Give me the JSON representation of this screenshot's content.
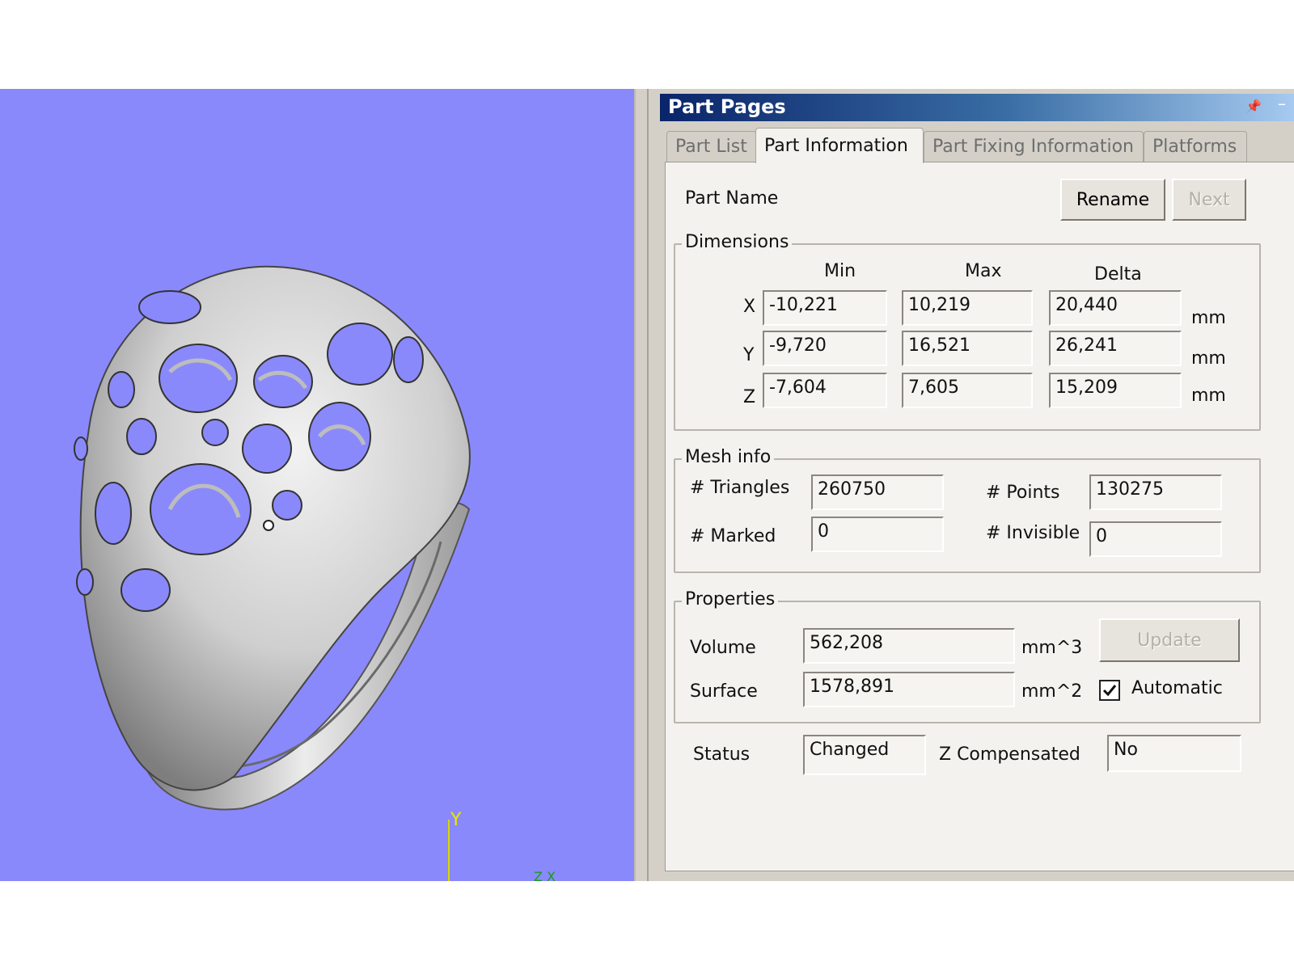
{
  "viewport": {
    "background_color": "#8a89fb",
    "model_color": "#c7c7c7",
    "axis_y_label": "Y",
    "axis_xz_label": "Z X"
  },
  "panel": {
    "title": "Part Pages",
    "pin_icon": "pin-icon",
    "minimize_icon": "minimize-icon",
    "tabs": [
      "Part List",
      "Part Information",
      "Part Fixing Information",
      "Platforms"
    ],
    "active_tab": "Part Information"
  },
  "part": {
    "name_label": "Part Name",
    "rename_label": "Rename",
    "next_label": "Next"
  },
  "dimensions": {
    "title": "Dimensions",
    "headers": [
      "Min",
      "Max",
      "Delta"
    ],
    "rows": [
      {
        "axis": "X",
        "min": "-10,221",
        "max": "10,219",
        "delta": "20,440",
        "unit": "mm"
      },
      {
        "axis": "Y",
        "min": "-9,720",
        "max": "16,521",
        "delta": "26,241",
        "unit": "mm"
      },
      {
        "axis": "Z",
        "min": "-7,604",
        "max": "7,605",
        "delta": "15,209",
        "unit": "mm"
      }
    ]
  },
  "mesh": {
    "title": "Mesh info",
    "triangles_label": "# Triangles",
    "triangles": "260750",
    "points_label": "# Points",
    "points": "130275",
    "marked_label": "# Marked",
    "marked": "0",
    "invisible_label": "# Invisible",
    "invisible": "0"
  },
  "properties": {
    "title": "Properties",
    "volume_label": "Volume",
    "volume": "562,208",
    "volume_unit": "mm^3",
    "surface_label": "Surface",
    "surface": "1578,891",
    "surface_unit": "mm^2",
    "update_label": "Update",
    "automatic_label": "Automatic",
    "automatic_checked": true
  },
  "status": {
    "status_label": "Status",
    "status_value": "Changed",
    "zcomp_label": "Z Compensated",
    "zcomp_value": "No"
  }
}
